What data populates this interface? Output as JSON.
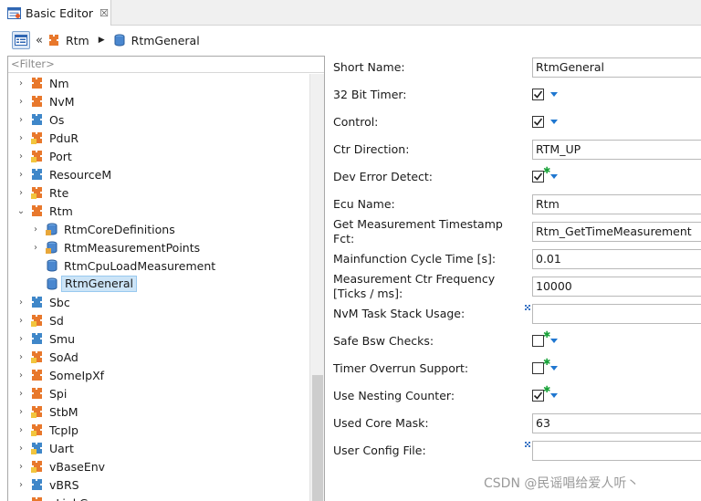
{
  "tab": {
    "label": "Basic Editor",
    "close_glyph": "☒"
  },
  "breadcrumb": {
    "back_glyph": "«",
    "items": [
      {
        "label": "Rtm",
        "icon": "module-icon"
      },
      {
        "label": "RtmGeneral",
        "icon": "container-icon"
      }
    ]
  },
  "filter": {
    "placeholder": "<Filter>"
  },
  "tree": {
    "items": [
      {
        "label": "Nm",
        "level": 0,
        "expander": "›"
      },
      {
        "label": "NvM",
        "level": 0,
        "expander": "›"
      },
      {
        "label": "Os",
        "level": 0,
        "expander": "›"
      },
      {
        "label": "PduR",
        "level": 0,
        "expander": "›"
      },
      {
        "label": "Port",
        "level": 0,
        "expander": "›"
      },
      {
        "label": "ResourceM",
        "level": 0,
        "expander": "›"
      },
      {
        "label": "Rte",
        "level": 0,
        "expander": "›"
      },
      {
        "label": "Rtm",
        "level": 0,
        "expander": "⌄"
      },
      {
        "label": "RtmCoreDefinitions",
        "level": 1,
        "expander": "›"
      },
      {
        "label": "RtmMeasurementPoints",
        "level": 1,
        "expander": "›"
      },
      {
        "label": "RtmCpuLoadMeasurement",
        "level": 1,
        "expander": ""
      },
      {
        "label": "RtmGeneral",
        "level": 1,
        "expander": "",
        "selected": true
      },
      {
        "label": "Sbc",
        "level": 0,
        "expander": "›"
      },
      {
        "label": "Sd",
        "level": 0,
        "expander": "›"
      },
      {
        "label": "Smu",
        "level": 0,
        "expander": "›"
      },
      {
        "label": "SoAd",
        "level": 0,
        "expander": "›"
      },
      {
        "label": "SomeIpXf",
        "level": 0,
        "expander": "›"
      },
      {
        "label": "Spi",
        "level": 0,
        "expander": "›"
      },
      {
        "label": "StbM",
        "level": 0,
        "expander": "›"
      },
      {
        "label": "TcpIp",
        "level": 0,
        "expander": "›"
      },
      {
        "label": "Uart",
        "level": 0,
        "expander": "›"
      },
      {
        "label": "vBaseEnv",
        "level": 0,
        "expander": "›"
      },
      {
        "label": "vBRS",
        "level": 0,
        "expander": "›"
      },
      {
        "label": "vLinkGen",
        "level": 0,
        "expander": "›"
      }
    ]
  },
  "properties": [
    {
      "label": "Short Name:",
      "type": "text",
      "value": "RtmGeneral"
    },
    {
      "label": "32 Bit Timer:",
      "type": "check",
      "checked": true,
      "modified": false
    },
    {
      "label": "Control:",
      "type": "check",
      "checked": true,
      "modified": false
    },
    {
      "label": "Ctr Direction:",
      "type": "text",
      "value": "RTM_UP"
    },
    {
      "label": "Dev Error Detect:",
      "type": "check",
      "checked": true,
      "modified": true
    },
    {
      "label": "Ecu Name:",
      "type": "text",
      "value": "Rtm"
    },
    {
      "label": "Get Measurement Timestamp Fct:",
      "type": "text",
      "value": "Rtm_GetTimeMeasurement"
    },
    {
      "label": "Mainfunction Cycle Time [s]:",
      "type": "text",
      "value": "0.01"
    },
    {
      "label": "Measurement Ctr Frequency [Ticks / ms]:",
      "type": "text",
      "value": "10000"
    },
    {
      "label": "NvM Task Stack Usage:",
      "type": "text",
      "value": "",
      "marker": true
    },
    {
      "label": "Safe Bsw Checks:",
      "type": "check",
      "checked": false,
      "modified": true
    },
    {
      "label": "Timer Overrun Support:",
      "type": "check",
      "checked": false,
      "modified": true
    },
    {
      "label": "Use Nesting Counter:",
      "type": "check",
      "checked": true,
      "modified": true
    },
    {
      "label": "Used Core Mask:",
      "type": "text",
      "value": "63"
    },
    {
      "label": "User Config File:",
      "type": "text",
      "value": "",
      "marker": true
    }
  ],
  "watermark": "CSDN @民谣唱给爱人听丶",
  "colors": {
    "accent": "#1f77d0",
    "modified": "#1aa33a",
    "selection": "#cce4f7"
  }
}
